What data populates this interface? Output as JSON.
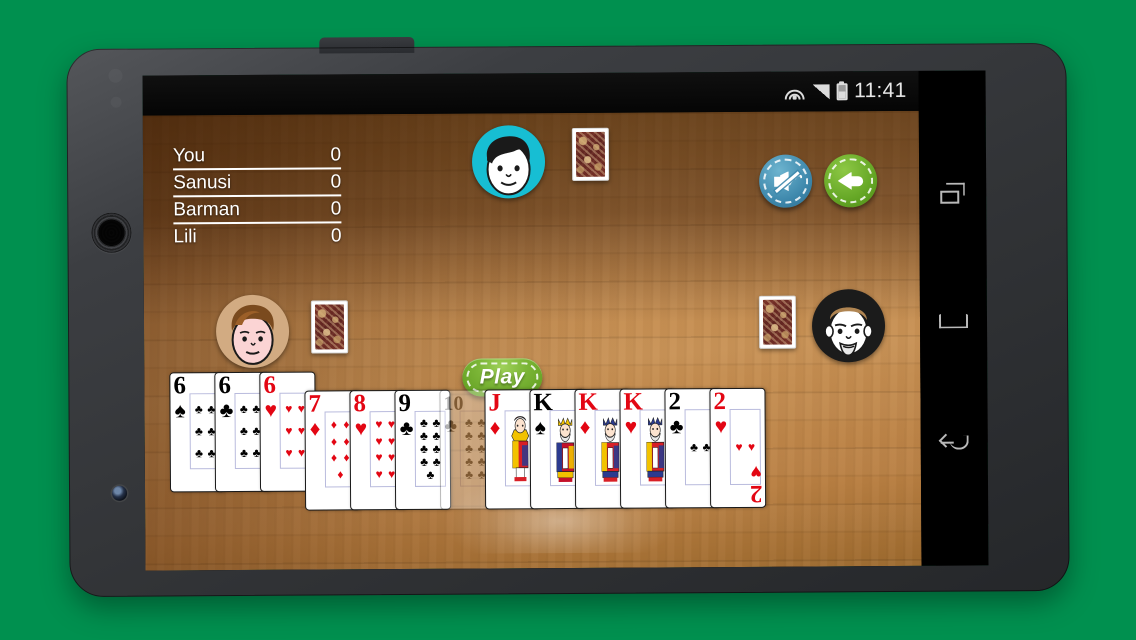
{
  "device": {
    "platform": "android-phone",
    "statusbar": {
      "time": "11:41",
      "icons": [
        "wifi-icon",
        "signal-icon",
        "battery-icon"
      ]
    },
    "navbar": {
      "recent_label": "Recent apps",
      "home_label": "Home",
      "back_label": "Back"
    }
  },
  "game": {
    "scoreboard": {
      "rows": [
        {
          "name": "You",
          "score": "0"
        },
        {
          "name": "Sanusi",
          "score": "0"
        },
        {
          "name": "Barman",
          "score": "0"
        },
        {
          "name": "Lili",
          "score": "0"
        }
      ]
    },
    "buttons": {
      "play": "Play",
      "mute": "mute-icon",
      "back": "back-arrow-icon"
    },
    "players": [
      {
        "seat": "top",
        "avatar_color": "#17bed3",
        "avatar": "avatar-top"
      },
      {
        "seat": "left",
        "avatar_color": "#d2ab82",
        "avatar": "avatar-left"
      },
      {
        "seat": "right",
        "avatar_color": "#1b1b1b",
        "avatar": "avatar-right"
      }
    ],
    "table_card_backs": 3,
    "hand": [
      {
        "rank": "6",
        "suit": "♠",
        "pip": "♣",
        "color": "blk",
        "count": 6,
        "faded": false,
        "face": null
      },
      {
        "rank": "6",
        "suit": "♣",
        "pip": "♣",
        "color": "blk",
        "count": 6,
        "faded": false,
        "face": null
      },
      {
        "rank": "6",
        "suit": "♥",
        "pip": "♥",
        "color": "red",
        "count": 6,
        "faded": false,
        "face": null
      },
      {
        "rank": "7",
        "suit": "♦",
        "pip": "♦",
        "color": "red",
        "count": 7,
        "faded": false,
        "face": null
      },
      {
        "rank": "8",
        "suit": "♥",
        "pip": "♥",
        "color": "red",
        "count": 8,
        "faded": false,
        "face": null
      },
      {
        "rank": "9",
        "suit": "♣",
        "pip": "♣",
        "color": "blk",
        "count": 9,
        "faded": false,
        "face": null
      },
      {
        "rank": "10",
        "suit": "♣",
        "pip": "♣",
        "color": "blk",
        "count": 10,
        "faded": true,
        "face": null
      },
      {
        "rank": "J",
        "suit": "♦",
        "pip": "♦",
        "color": "red",
        "count": 0,
        "faded": false,
        "face": "jack"
      },
      {
        "rank": "K",
        "suit": "♠",
        "pip": "♠",
        "color": "blk",
        "count": 0,
        "faded": false,
        "face": "king"
      },
      {
        "rank": "K",
        "suit": "♦",
        "pip": "♦",
        "color": "red",
        "count": 0,
        "faded": false,
        "face": "king"
      },
      {
        "rank": "K",
        "suit": "♥",
        "pip": "♥",
        "color": "red",
        "count": 0,
        "faded": false,
        "face": "king"
      },
      {
        "rank": "2",
        "suit": "♣",
        "pip": "♣",
        "color": "blk",
        "count": 2,
        "faded": false,
        "face": null
      },
      {
        "rank": "2",
        "suit": "♥",
        "pip": "♥",
        "color": "red",
        "count": 2,
        "faded": false,
        "face": null
      }
    ]
  }
}
